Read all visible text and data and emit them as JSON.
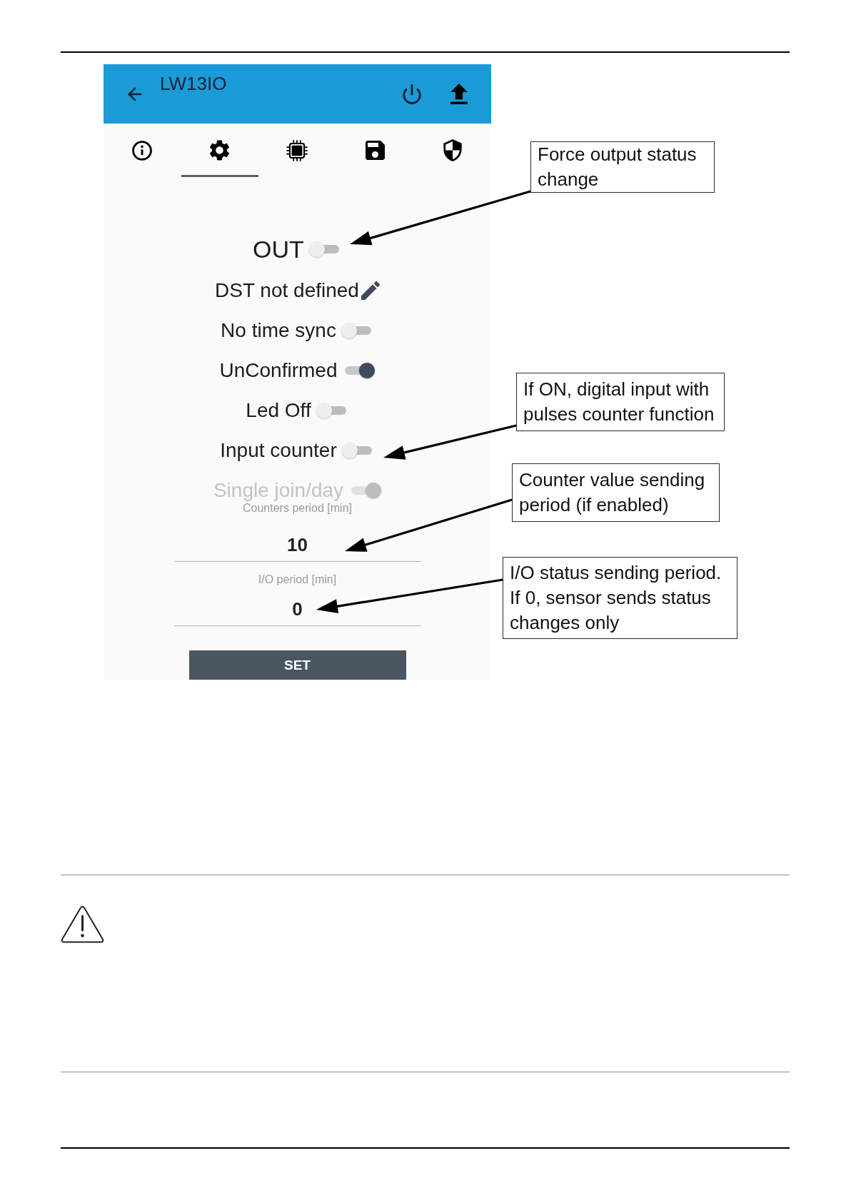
{
  "app_bar": {
    "title": "LW13IO"
  },
  "tabs": [
    {
      "selected": false
    },
    {
      "selected": true
    },
    {
      "selected": false
    },
    {
      "selected": false
    },
    {
      "selected": false
    }
  ],
  "settings": [
    {
      "kind": "output_switch",
      "label": "OUT",
      "on": false,
      "disabled": false
    },
    {
      "kind": "edit",
      "label": "DST not defined"
    },
    {
      "kind": "switch",
      "label": "No time sync",
      "on": false,
      "disabled": false
    },
    {
      "kind": "switch",
      "label": "UnConfirmed",
      "on": true,
      "disabled": false
    },
    {
      "kind": "switch",
      "label": "Led Off",
      "on": false,
      "disabled": false
    },
    {
      "kind": "switch",
      "label": "Input counter",
      "on": false,
      "disabled": false
    },
    {
      "kind": "switch",
      "label": "Single join/day",
      "on": true,
      "disabled": true
    }
  ],
  "fields": [
    {
      "label": "Counters period [min]",
      "value": "10"
    },
    {
      "label": "I/O period [min]",
      "value": "0"
    }
  ],
  "set_button": {
    "label": "SET"
  },
  "callouts": [
    {
      "lines": [
        "Force output status",
        "change"
      ]
    },
    {
      "lines": [
        "If ON, digital input with",
        "pulses counter function"
      ]
    },
    {
      "lines": [
        "Counter value sending",
        "period (if enabled)"
      ]
    },
    {
      "lines": [
        "I/O status sending period.",
        "If 0, sensor sends status",
        "changes only"
      ]
    }
  ]
}
